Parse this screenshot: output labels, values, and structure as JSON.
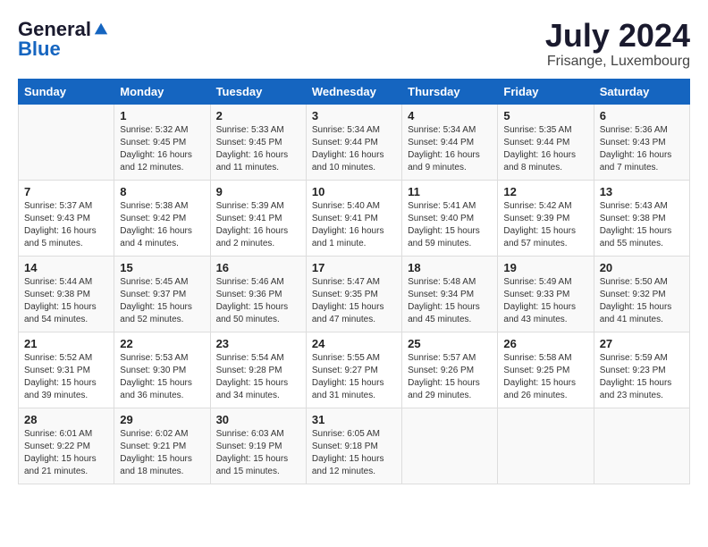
{
  "header": {
    "logo_general": "General",
    "logo_blue": "Blue",
    "month_year": "July 2024",
    "location": "Frisange, Luxembourg"
  },
  "weekdays": [
    "Sunday",
    "Monday",
    "Tuesday",
    "Wednesday",
    "Thursday",
    "Friday",
    "Saturday"
  ],
  "weeks": [
    [
      {
        "day": "",
        "sunrise": "",
        "sunset": "",
        "daylight": ""
      },
      {
        "day": "1",
        "sunrise": "Sunrise: 5:32 AM",
        "sunset": "Sunset: 9:45 PM",
        "daylight": "Daylight: 16 hours and 12 minutes."
      },
      {
        "day": "2",
        "sunrise": "Sunrise: 5:33 AM",
        "sunset": "Sunset: 9:45 PM",
        "daylight": "Daylight: 16 hours and 11 minutes."
      },
      {
        "day": "3",
        "sunrise": "Sunrise: 5:34 AM",
        "sunset": "Sunset: 9:44 PM",
        "daylight": "Daylight: 16 hours and 10 minutes."
      },
      {
        "day": "4",
        "sunrise": "Sunrise: 5:34 AM",
        "sunset": "Sunset: 9:44 PM",
        "daylight": "Daylight: 16 hours and 9 minutes."
      },
      {
        "day": "5",
        "sunrise": "Sunrise: 5:35 AM",
        "sunset": "Sunset: 9:44 PM",
        "daylight": "Daylight: 16 hours and 8 minutes."
      },
      {
        "day": "6",
        "sunrise": "Sunrise: 5:36 AM",
        "sunset": "Sunset: 9:43 PM",
        "daylight": "Daylight: 16 hours and 7 minutes."
      }
    ],
    [
      {
        "day": "7",
        "sunrise": "Sunrise: 5:37 AM",
        "sunset": "Sunset: 9:43 PM",
        "daylight": "Daylight: 16 hours and 5 minutes."
      },
      {
        "day": "8",
        "sunrise": "Sunrise: 5:38 AM",
        "sunset": "Sunset: 9:42 PM",
        "daylight": "Daylight: 16 hours and 4 minutes."
      },
      {
        "day": "9",
        "sunrise": "Sunrise: 5:39 AM",
        "sunset": "Sunset: 9:41 PM",
        "daylight": "Daylight: 16 hours and 2 minutes."
      },
      {
        "day": "10",
        "sunrise": "Sunrise: 5:40 AM",
        "sunset": "Sunset: 9:41 PM",
        "daylight": "Daylight: 16 hours and 1 minute."
      },
      {
        "day": "11",
        "sunrise": "Sunrise: 5:41 AM",
        "sunset": "Sunset: 9:40 PM",
        "daylight": "Daylight: 15 hours and 59 minutes."
      },
      {
        "day": "12",
        "sunrise": "Sunrise: 5:42 AM",
        "sunset": "Sunset: 9:39 PM",
        "daylight": "Daylight: 15 hours and 57 minutes."
      },
      {
        "day": "13",
        "sunrise": "Sunrise: 5:43 AM",
        "sunset": "Sunset: 9:38 PM",
        "daylight": "Daylight: 15 hours and 55 minutes."
      }
    ],
    [
      {
        "day": "14",
        "sunrise": "Sunrise: 5:44 AM",
        "sunset": "Sunset: 9:38 PM",
        "daylight": "Daylight: 15 hours and 54 minutes."
      },
      {
        "day": "15",
        "sunrise": "Sunrise: 5:45 AM",
        "sunset": "Sunset: 9:37 PM",
        "daylight": "Daylight: 15 hours and 52 minutes."
      },
      {
        "day": "16",
        "sunrise": "Sunrise: 5:46 AM",
        "sunset": "Sunset: 9:36 PM",
        "daylight": "Daylight: 15 hours and 50 minutes."
      },
      {
        "day": "17",
        "sunrise": "Sunrise: 5:47 AM",
        "sunset": "Sunset: 9:35 PM",
        "daylight": "Daylight: 15 hours and 47 minutes."
      },
      {
        "day": "18",
        "sunrise": "Sunrise: 5:48 AM",
        "sunset": "Sunset: 9:34 PM",
        "daylight": "Daylight: 15 hours and 45 minutes."
      },
      {
        "day": "19",
        "sunrise": "Sunrise: 5:49 AM",
        "sunset": "Sunset: 9:33 PM",
        "daylight": "Daylight: 15 hours and 43 minutes."
      },
      {
        "day": "20",
        "sunrise": "Sunrise: 5:50 AM",
        "sunset": "Sunset: 9:32 PM",
        "daylight": "Daylight: 15 hours and 41 minutes."
      }
    ],
    [
      {
        "day": "21",
        "sunrise": "Sunrise: 5:52 AM",
        "sunset": "Sunset: 9:31 PM",
        "daylight": "Daylight: 15 hours and 39 minutes."
      },
      {
        "day": "22",
        "sunrise": "Sunrise: 5:53 AM",
        "sunset": "Sunset: 9:30 PM",
        "daylight": "Daylight: 15 hours and 36 minutes."
      },
      {
        "day": "23",
        "sunrise": "Sunrise: 5:54 AM",
        "sunset": "Sunset: 9:28 PM",
        "daylight": "Daylight: 15 hours and 34 minutes."
      },
      {
        "day": "24",
        "sunrise": "Sunrise: 5:55 AM",
        "sunset": "Sunset: 9:27 PM",
        "daylight": "Daylight: 15 hours and 31 minutes."
      },
      {
        "day": "25",
        "sunrise": "Sunrise: 5:57 AM",
        "sunset": "Sunset: 9:26 PM",
        "daylight": "Daylight: 15 hours and 29 minutes."
      },
      {
        "day": "26",
        "sunrise": "Sunrise: 5:58 AM",
        "sunset": "Sunset: 9:25 PM",
        "daylight": "Daylight: 15 hours and 26 minutes."
      },
      {
        "day": "27",
        "sunrise": "Sunrise: 5:59 AM",
        "sunset": "Sunset: 9:23 PM",
        "daylight": "Daylight: 15 hours and 23 minutes."
      }
    ],
    [
      {
        "day": "28",
        "sunrise": "Sunrise: 6:01 AM",
        "sunset": "Sunset: 9:22 PM",
        "daylight": "Daylight: 15 hours and 21 minutes."
      },
      {
        "day": "29",
        "sunrise": "Sunrise: 6:02 AM",
        "sunset": "Sunset: 9:21 PM",
        "daylight": "Daylight: 15 hours and 18 minutes."
      },
      {
        "day": "30",
        "sunrise": "Sunrise: 6:03 AM",
        "sunset": "Sunset: 9:19 PM",
        "daylight": "Daylight: 15 hours and 15 minutes."
      },
      {
        "day": "31",
        "sunrise": "Sunrise: 6:05 AM",
        "sunset": "Sunset: 9:18 PM",
        "daylight": "Daylight: 15 hours and 12 minutes."
      },
      {
        "day": "",
        "sunrise": "",
        "sunset": "",
        "daylight": ""
      },
      {
        "day": "",
        "sunrise": "",
        "sunset": "",
        "daylight": ""
      },
      {
        "day": "",
        "sunrise": "",
        "sunset": "",
        "daylight": ""
      }
    ]
  ]
}
